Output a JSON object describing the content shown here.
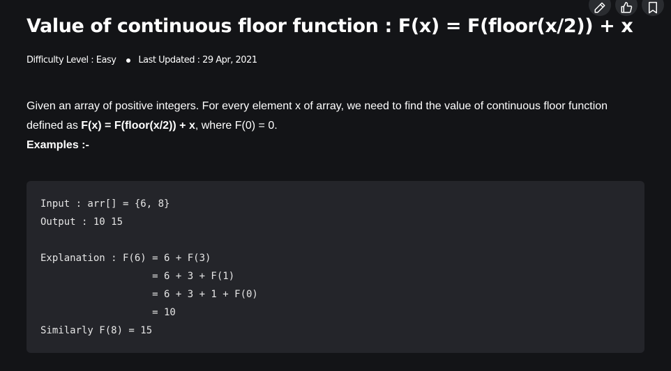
{
  "article": {
    "title": "Value of continuous floor function : F(x) = F(floor(x/2)) + x",
    "difficulty": "Difficulty Level : Easy",
    "updated": "Last Updated : 29 Apr, 2021"
  },
  "toolbar": {
    "edit_icon": "pencil-icon",
    "like_icon": "thumbs-up-icon",
    "bookmark_icon": "bookmark-icon"
  },
  "description": {
    "text1": "Given an array of positive integers. For every element x of array, we need to find the value of continuous floor function defined as ",
    "formula": "F(x) = F(floor(x/2)) + x",
    "text2": ", where F(0) = 0.",
    "examples_label": "Examples :-"
  },
  "code": {
    "lines": "Input : arr[] = {6, 8}\nOutput : 10 15\n\nExplanation : F(6) = 6 + F(3)\n                   = 6 + 3 + F(1)\n                   = 6 + 3 + 1 + F(0)\n                   = 10\nSimilarly F(8) = 15"
  }
}
